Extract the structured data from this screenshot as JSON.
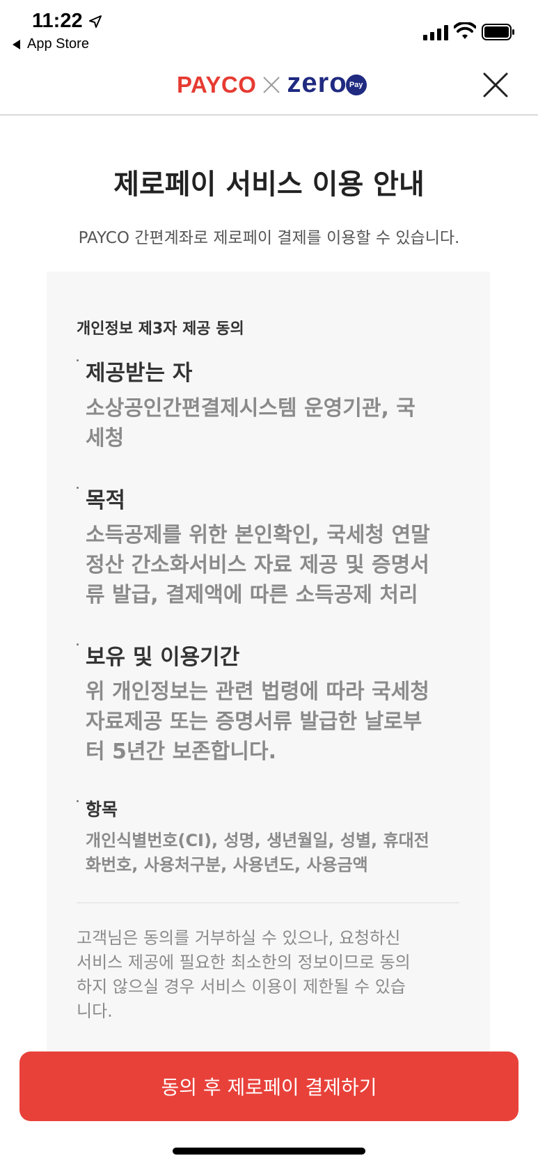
{
  "status_bar": {
    "time": "11:22",
    "back_app": "App Store"
  },
  "header": {
    "brand_left": "PAYCO",
    "brand_right": "zero",
    "brand_badge": "Pay"
  },
  "page": {
    "title": "제로페이 서비스 이용 안내",
    "subtitle": "PAYCO 간편계좌로 제로페이 결제를 이용할 수 있습니다."
  },
  "consent": {
    "section_title": "개인정보 제3자 제공 동의",
    "items": [
      {
        "head": "제공받는 자",
        "body": "소상공인간편결제시스템 운영기관, 국\n세청"
      },
      {
        "head": "목적",
        "body": "소득공제를 위한 본인확인, 국세청 연말\n정산 간소화서비스 자료 제공 및 증명서\n류 발급, 결제액에 따른 소득공제 처리"
      },
      {
        "head": "보유 및 이용기간",
        "body": "위 개인정보는 관련 법령에 따라 국세청\n자료제공 또는 증명서류 발급한 날로부\n터 5년간 보존합니다."
      },
      {
        "head": "항목",
        "body": "개인식별번호(CI), 성명, 생년월일, 성별, 휴대전\n화번호, 사용처구분, 사용년도, 사용금액"
      }
    ],
    "notice": "고객님은 동의를 거부하실 수 있으나, 요청하신\n서비스 제공에 필요한 최소한의 정보이므로 동의\n하지 않으실 경우 서비스 이용이 제한될 수 있습\n니다."
  },
  "cta": {
    "label": "동의 후 제로페이 결제하기"
  },
  "colors": {
    "accent": "#e8413a",
    "brand_red": "#e63b32",
    "brand_navy": "#1f2a80",
    "panel_bg": "#f7f7f7"
  }
}
